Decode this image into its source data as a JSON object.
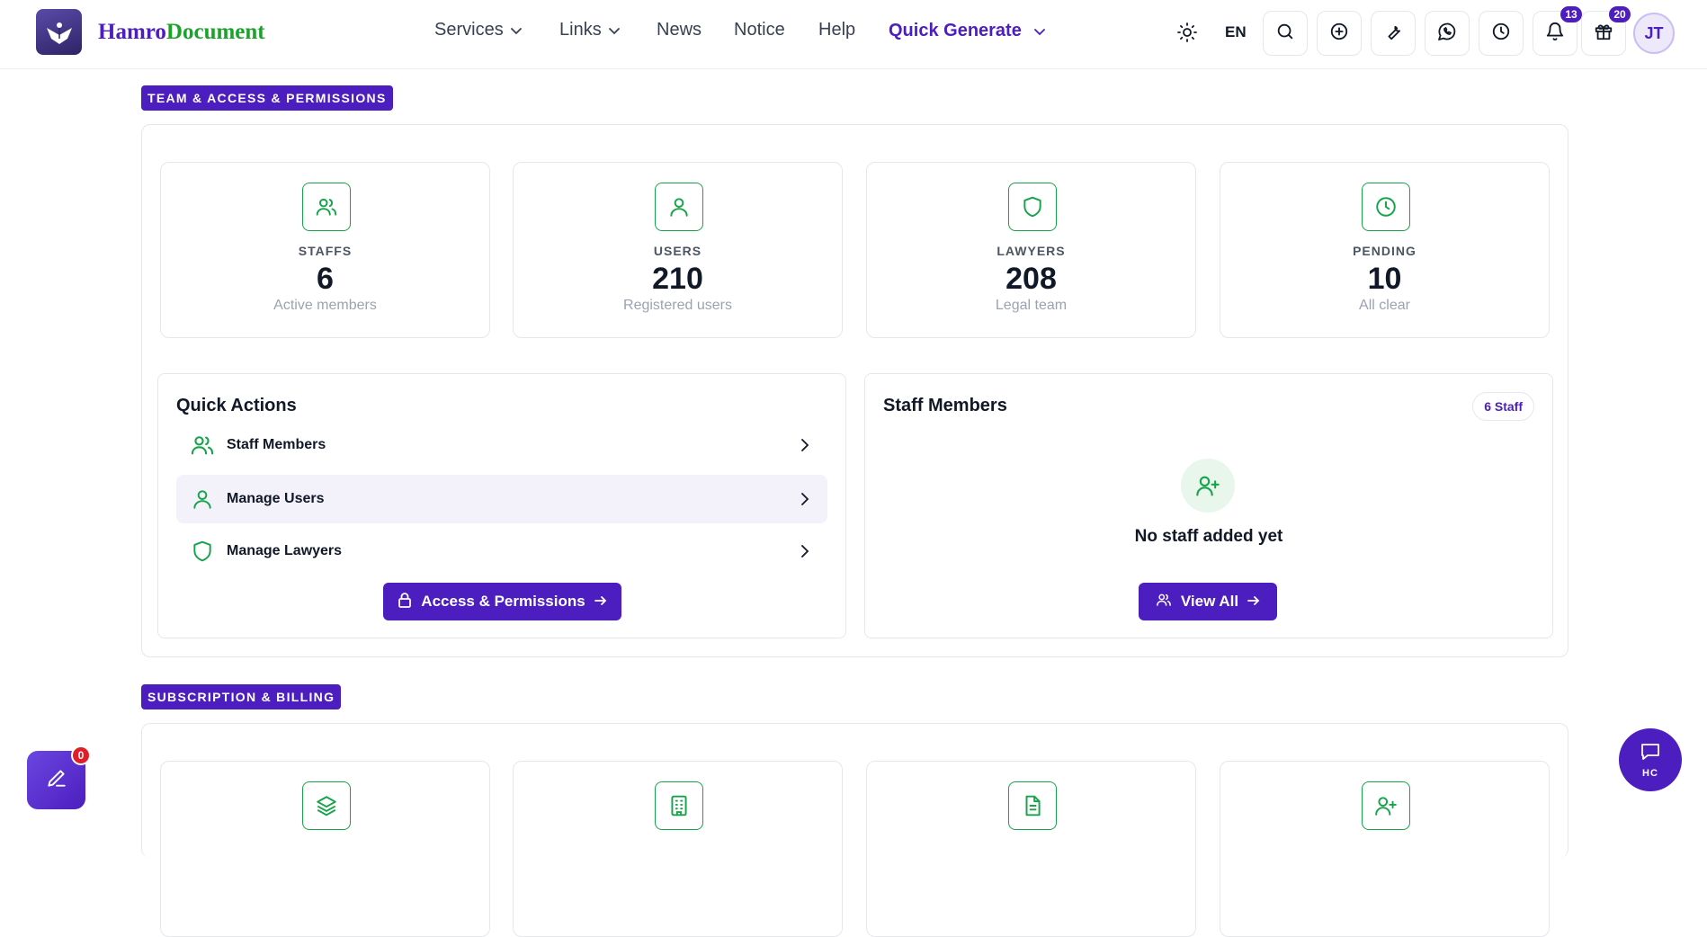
{
  "brand": {
    "part1": "Hamro",
    "part2": "Document"
  },
  "nav": {
    "services": "Services",
    "links": "Links",
    "news": "News",
    "notice": "Notice",
    "help": "Help",
    "quick_generate": "Quick Generate"
  },
  "header": {
    "language": "EN",
    "notifications_count": "13",
    "gifts_count": "20",
    "avatar_initials": "JT"
  },
  "sections": {
    "team": "TEAM & ACCESS & PERMISSIONS",
    "billing": "SUBSCRIPTION & BILLING"
  },
  "stats": [
    {
      "label": "STAFFS",
      "value": "6",
      "sub": "Active members",
      "icon": "users-icon"
    },
    {
      "label": "USERS",
      "value": "210",
      "sub": "Registered users",
      "icon": "user-icon"
    },
    {
      "label": "LAWYERS",
      "value": "208",
      "sub": "Legal team",
      "icon": "shield-icon"
    },
    {
      "label": "PENDING",
      "value": "10",
      "sub": "All clear",
      "icon": "clock-icon"
    }
  ],
  "quick_actions": {
    "title": "Quick Actions",
    "items": [
      {
        "label": "Staff Members",
        "icon": "users-icon"
      },
      {
        "label": "Manage Users",
        "icon": "user-icon"
      },
      {
        "label": "Manage Lawyers",
        "icon": "shield-icon"
      }
    ],
    "button": "Access & Permissions"
  },
  "staff_members": {
    "title": "Staff Members",
    "badge": "6 Staff",
    "empty_text": "No staff added yet",
    "button": "View All"
  },
  "billing_icons": [
    "layers-icon",
    "building-icon",
    "document-icon",
    "user-plus-icon"
  ],
  "floating": {
    "edit_badge": "0",
    "chat_label": "HC"
  },
  "colors": {
    "primary": "#4c1ebf",
    "green": "#16a34a",
    "red_badge": "#e11d2a"
  }
}
